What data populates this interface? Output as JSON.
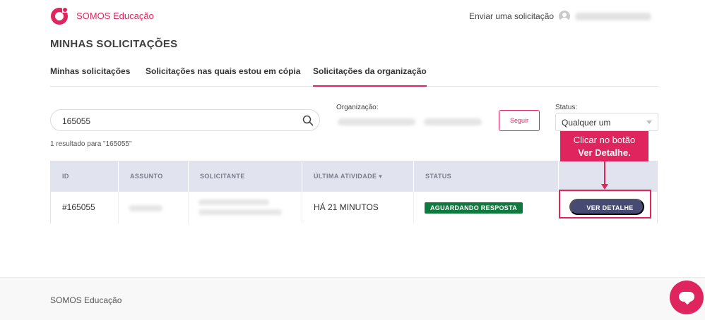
{
  "header": {
    "brand": "SOMOS Educação",
    "nav_link": "Enviar uma solicitação"
  },
  "page": {
    "title": "MINHAS SOLICITAÇÕES"
  },
  "tabs": [
    {
      "label": "Minhas solicitações",
      "active": false
    },
    {
      "label": "Solicitações nas quais estou em cópia",
      "active": false
    },
    {
      "label": "Solicitações da organização",
      "active": true
    }
  ],
  "search": {
    "value": "165055",
    "result_count": "1 resultado para \"165055\""
  },
  "filters": {
    "organization_label": "Organização:",
    "follow_label": "Seguir",
    "status_label": "Status:",
    "status_value": "Qualquer um"
  },
  "table": {
    "headers": [
      "ID",
      "ASSUNTO",
      "SOLICITANTE",
      "ÚLTIMA ATIVIDADE ▾",
      "STATUS",
      ""
    ],
    "rows": [
      {
        "id": "#165055",
        "last_activity": "HÁ 21 MINUTOS",
        "status": "AGUARDANDO RESPOSTA",
        "action": "VER DETALHE"
      }
    ]
  },
  "callout": {
    "line1": "Clicar no botão",
    "line2": "Ver Detalhe."
  },
  "footer": {
    "text": "SOMOS Educação"
  },
  "colors": {
    "brand": "#e0245e",
    "badge_green": "#0f7a3e",
    "button_navy": "#474b74",
    "header_bg": "#e1e3ee"
  }
}
